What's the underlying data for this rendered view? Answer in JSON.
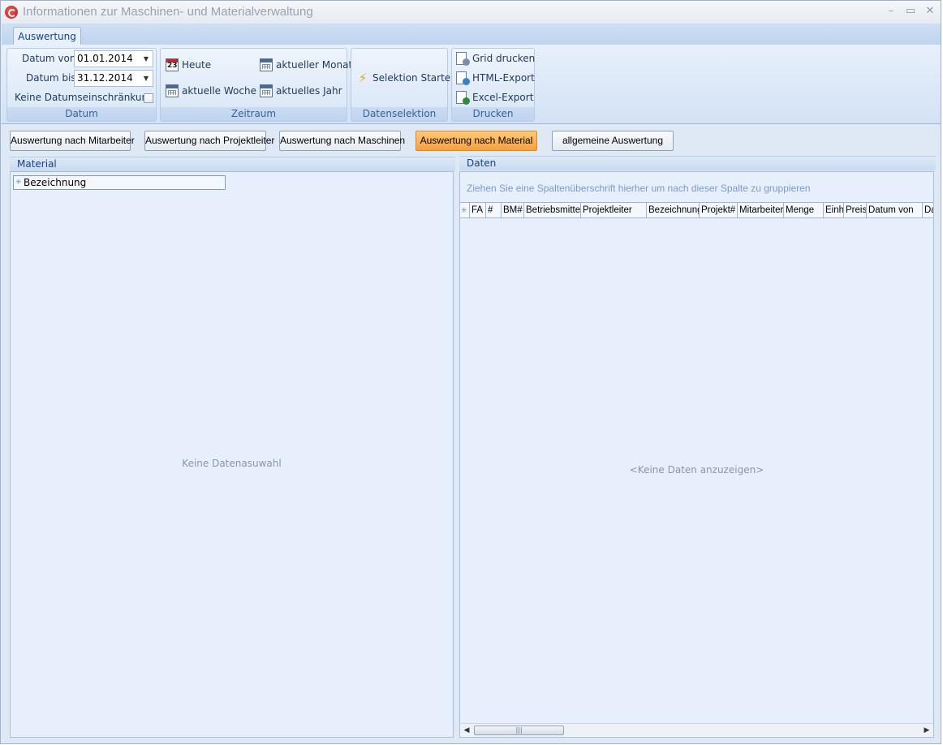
{
  "window": {
    "title": "Informationen zur Maschinen- und Materialverwaltung",
    "controls": {
      "minimize": "–",
      "maximize": "▭",
      "close": "✕"
    }
  },
  "ribbon": {
    "tabs": [
      "Auswertung"
    ],
    "datum": {
      "caption": "Datum",
      "von_label": "Datum von",
      "von_value": "01.01.2014",
      "bis_label": "Datum bis",
      "bis_value": "31.12.2014",
      "keine_label": "Keine Datumseinschränkung"
    },
    "zeitraum": {
      "caption": "Zeitraum",
      "heute": "Heute",
      "heute_icon_num": "23",
      "woche": "aktuelle Woche",
      "monat": "aktueller Monat",
      "jahr": "aktuelles Jahr"
    },
    "datenselektion": {
      "caption": "Datenselektion",
      "start": "Selektion Starten"
    },
    "drucken": {
      "caption": "Drucken",
      "grid": "Grid drucken",
      "html": "HTML-Export",
      "excel": "Excel-Export"
    }
  },
  "modes": [
    "Auswertung nach Mitarbeiter",
    "Auswertung nach Projektleiter",
    "Auswertung nach Maschinen",
    "Auswertung nach Material",
    "allgemeine Auswertung"
  ],
  "active_mode": "Auswertung nach Material",
  "left_panel": {
    "title": "Material",
    "column": "Bezeichnung",
    "empty": "Keine Datenasuwahl"
  },
  "right_panel": {
    "title": "Daten",
    "group_hint": "Ziehen Sie eine Spaltenüberschrift hierher um nach dieser Spalte zu gruppieren",
    "columns": [
      "FA",
      "#",
      "BM#",
      "Betriebsmittel",
      "Projektleiter",
      "Bezeichnung",
      "Projekt#",
      "Mitarbeiter",
      "Menge",
      "Einh",
      "Preis",
      "Datum von",
      "Da"
    ],
    "empty": "<Keine Daten anzuzeigen>"
  },
  "colors": {
    "accent": "#15428b",
    "active_button": "#f6a03e",
    "panel_bg": "#e6effb"
  }
}
